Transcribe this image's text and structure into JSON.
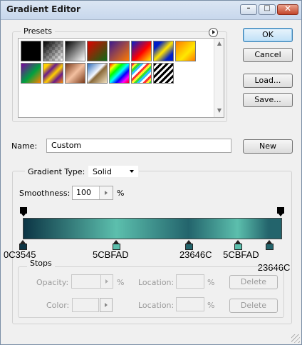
{
  "window": {
    "title": "Gradient Editor",
    "controls": {
      "minimize": "–",
      "maximize": "□",
      "close": "✕"
    }
  },
  "buttons": {
    "ok": "OK",
    "cancel": "Cancel",
    "load": "Load...",
    "save": "Save...",
    "new": "New"
  },
  "presets": {
    "label": "Presets",
    "menu_icon": "circle-arrow-icon",
    "swatches": [
      "black",
      "transparent-checker",
      "black-white",
      "red-green",
      "violet-orange",
      "blue-red-yellow",
      "blue-yellow-blue",
      "orange-yellow",
      "violet-green-orange",
      "yellow-violet-orange",
      "copper",
      "chrome",
      "spectrum",
      "transparent-rainbow",
      "transparent-stripes"
    ]
  },
  "name": {
    "label": "Name:",
    "value": "Custom"
  },
  "gradient": {
    "type_label": "Gradient Type:",
    "type_value": "Solid",
    "smoothness_label": "Smoothness:",
    "smoothness_value": "100",
    "smoothness_unit": "%",
    "stops": [
      {
        "position": 0,
        "color": "#0C3545",
        "label": "0C3545"
      },
      {
        "position": 36,
        "color": "#5CBFAD",
        "label": "5CBFAD"
      },
      {
        "position": 64,
        "color": "#23646C",
        "label": "23646C"
      },
      {
        "position": 83,
        "color": "#5CBFAD",
        "label": "5CBFAD"
      },
      {
        "position": 95,
        "color": "#23646C",
        "label": "23646C"
      }
    ],
    "opacity_stops": [
      0,
      100
    ]
  },
  "stops_group": {
    "label": "Stops",
    "opacity_label": "Opacity:",
    "opacity_unit": "%",
    "location_label": "Location:",
    "location_unit": "%",
    "delete_label": "Delete",
    "color_label": "Color:",
    "color_location_label": "Location:",
    "color_location_unit": "%",
    "color_delete_label": "Delete"
  }
}
